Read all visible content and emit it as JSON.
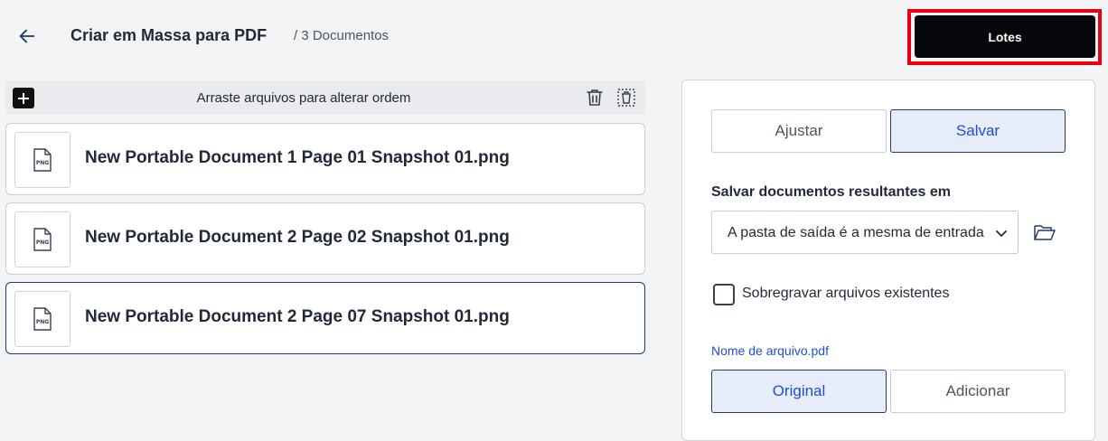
{
  "header": {
    "title": "Criar em Massa para PDF",
    "subtitle": "/ 3 Documentos",
    "lotes_label": "Lotes"
  },
  "toolbar": {
    "hint": "Arraste arquivos para alterar ordem"
  },
  "files": [
    {
      "thumb_label": "PNG",
      "name": "New Portable Document 1 Page 01 Snapshot 01.png"
    },
    {
      "thumb_label": "PNG",
      "name": "New Portable Document 2 Page 02 Snapshot 01.png"
    },
    {
      "thumb_label": "PNG",
      "name": "New Portable Document 2 Page 07 Snapshot 01.png"
    }
  ],
  "panel": {
    "tabs": {
      "adjust": "Ajustar",
      "save": "Salvar"
    },
    "save_location_label": "Salvar documentos resultantes em",
    "save_location_value": "A pasta de saída é a mesma de entrada",
    "overwrite_label": "Sobregravar arquivos existentes",
    "filename_label": "Nome de arquivo.pdf",
    "name_options": {
      "original": "Original",
      "add": "Adicionar"
    }
  },
  "colors": {
    "accent": "#1d4ed8",
    "highlight": "#e60012",
    "dark_button": "#05070b"
  }
}
